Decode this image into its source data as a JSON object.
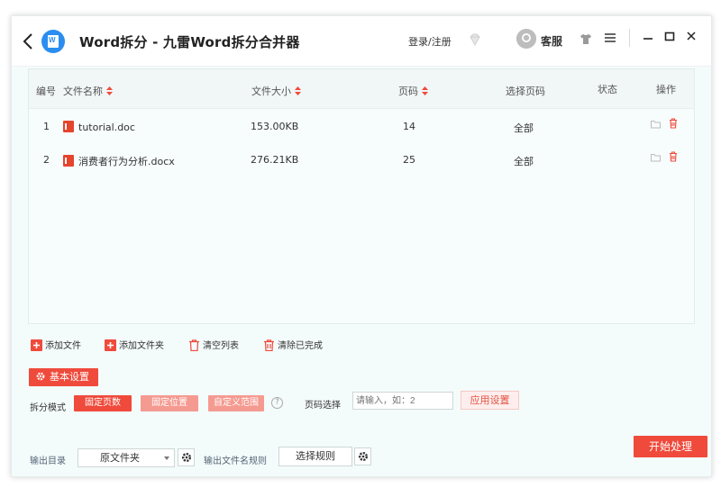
{
  "titlebar": {
    "app_title": "Word拆分 - 九雷Word拆分合并器",
    "login": "登录/注册",
    "service": "客服"
  },
  "table": {
    "columns": [
      "编号",
      "文件名称",
      "文件大小",
      "页码",
      "选择页码",
      "状态",
      "操作"
    ],
    "rows": [
      {
        "index": "1",
        "name": "tutorial.doc",
        "size": "153.00KB",
        "pages": "14",
        "select": "全部",
        "status": ""
      },
      {
        "index": "2",
        "name": "消费者行为分析.docx",
        "size": "276.21KB",
        "pages": "25",
        "select": "全部",
        "status": ""
      }
    ]
  },
  "toolbar": {
    "add_file": "添加文件",
    "add_folder": "添加文件夹",
    "clear_list": "清空列表",
    "clear_done": "清除已完成"
  },
  "settings": {
    "title": "基本设置",
    "split_mode_label": "拆分模式",
    "modes": [
      "固定页数",
      "固定位置",
      "自定义范围"
    ],
    "help": "?",
    "page_select_label": "页码选择",
    "page_placeholder": "请输入，如：2",
    "apply": "应用设置"
  },
  "output": {
    "dir_label": "输出目录",
    "dir_value": "原文件夹",
    "name_rule_label": "输出文件名规则",
    "rule_button": "选择规则",
    "start": "开始处理"
  },
  "colors": {
    "accent": "#ef4a3b",
    "accent_light": "#f59a90",
    "background": "#f4fbfb"
  }
}
